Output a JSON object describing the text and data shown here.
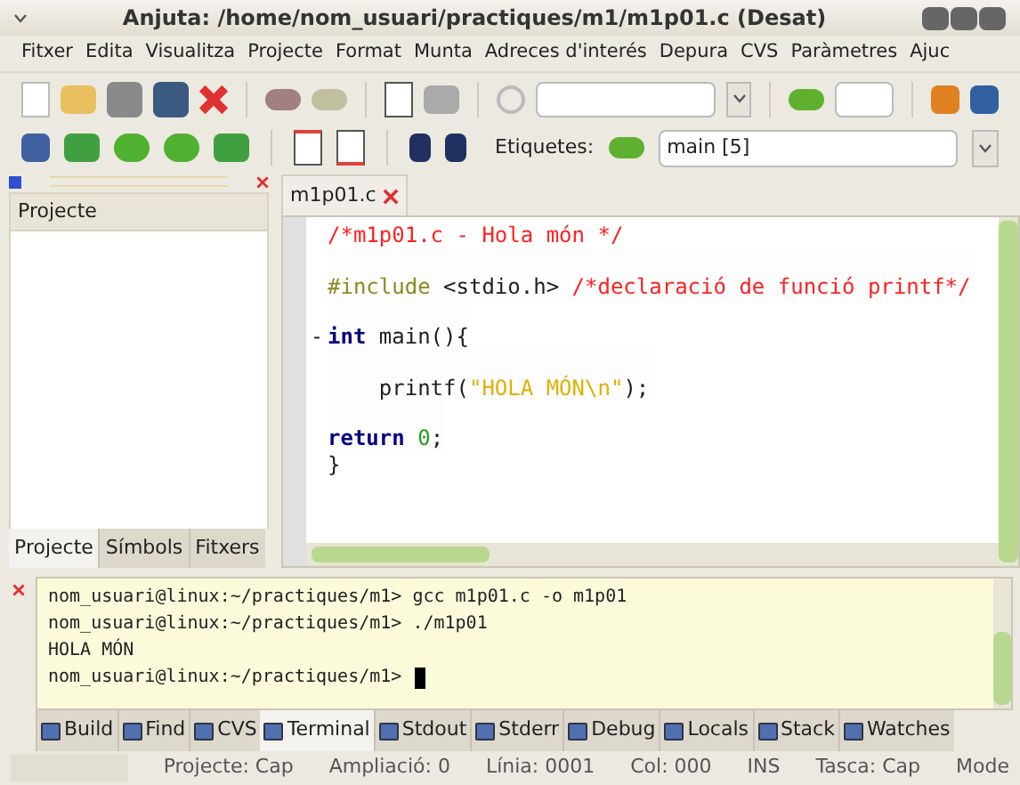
{
  "window": {
    "title": "Anjuta: /home/nom_usuari/practiques/m1/m1p01.c (Desat)"
  },
  "menu": [
    "Fitxer",
    "Edita",
    "Visualitza",
    "Projecte",
    "Format",
    "Munta",
    "Adreces d'interés",
    "Depura",
    "CVS",
    "Paràmetres",
    "Ajuc"
  ],
  "toolbar2": {
    "tags_label": "Etiquetes:",
    "tags_value": "main [5]"
  },
  "sidebar": {
    "header": "Projecte",
    "tabs": [
      {
        "label": "Projecte",
        "selected": true
      },
      {
        "label": "Símbols",
        "selected": false
      },
      {
        "label": "Fitxers",
        "selected": false
      }
    ]
  },
  "editor": {
    "tab": "m1p01.c",
    "lines": [
      {
        "segments": [
          {
            "kind": "comment",
            "text": "/*m1p01.c - Hola món */"
          }
        ]
      },
      {
        "blank_before": true,
        "segments": [
          {
            "kind": "preproc",
            "text": "#include"
          },
          {
            "kind": "plain",
            "text": " <stdio.h> "
          },
          {
            "kind": "comment",
            "text": "/*declaració de funció printf*/"
          }
        ]
      },
      {
        "blank_before": true,
        "fold": "-",
        "segments": [
          {
            "kind": "keyword",
            "text": "int"
          },
          {
            "kind": "plain",
            "text": " main(){"
          }
        ]
      },
      {
        "blank_before": true,
        "segments": [
          {
            "kind": "plain",
            "text": "    printf("
          },
          {
            "kind": "string",
            "text": "\"HOLA MÓN\\n\""
          },
          {
            "kind": "plain",
            "text": ");"
          }
        ]
      },
      {
        "blank_before": true,
        "segments": [
          {
            "kind": "keyword",
            "text": "return"
          },
          {
            "kind": "number",
            "text": " 0"
          },
          {
            "kind": "plain",
            "text": ";"
          }
        ]
      },
      {
        "segments": [
          {
            "kind": "plain",
            "text": "}"
          }
        ]
      }
    ]
  },
  "terminal": {
    "lines": [
      "nom_usuari@linux:~/practiques/m1> gcc m1p01.c -o m1p01",
      "nom_usuari@linux:~/practiques/m1> ./m1p01",
      "HOLA MÓN",
      "nom_usuari@linux:~/practiques/m1>"
    ]
  },
  "bottom_tabs": [
    {
      "label": "Build",
      "selected": false
    },
    {
      "label": "Find",
      "selected": false
    },
    {
      "label": "CVS",
      "selected": false
    },
    {
      "label": "Terminal",
      "selected": true
    },
    {
      "label": "Stdout",
      "selected": false
    },
    {
      "label": "Stderr",
      "selected": false
    },
    {
      "label": "Debug",
      "selected": false
    },
    {
      "label": "Locals",
      "selected": false
    },
    {
      "label": "Stack",
      "selected": false
    },
    {
      "label": "Watches",
      "selected": false
    }
  ],
  "status_bar": [
    "Projecte: Cap",
    "Ampliació: 0",
    "Línia: 0001",
    "Col: 000",
    "INS",
    "Tasca: Cap",
    "Mode"
  ]
}
